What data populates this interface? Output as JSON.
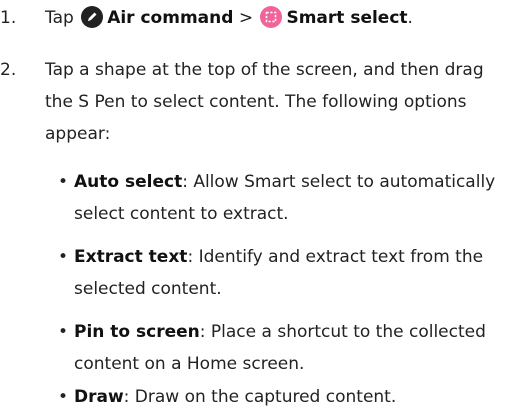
{
  "steps": [
    {
      "number": "1.",
      "prefix": "Tap",
      "air_command_icon": "pen-circle-icon",
      "air_command_label": "Air command",
      "separator": ">",
      "smart_select_icon": "smart-select-icon",
      "smart_select_label": "Smart select",
      "suffix": "."
    },
    {
      "number": "2.",
      "text": "Tap a shape at the top of the screen, and then drag the S Pen to select content. The following options appear:"
    }
  ],
  "options": [
    {
      "bullet": "•",
      "term": "Auto select",
      "description": ": Allow Smart select to automatically select content to extract."
    },
    {
      "bullet": "•",
      "term": "Extract text",
      "description": ": Identify and extract text from the selected content."
    },
    {
      "bullet": "•",
      "term": "Pin to screen",
      "description": ": Place a shortcut to the collected content on a Home screen."
    },
    {
      "bullet": "•",
      "term": "Draw",
      "description": ": Draw on the captured content."
    }
  ],
  "colors": {
    "air_command_icon_bg": "#222222",
    "smart_select_icon_bg": "#f0649a"
  }
}
